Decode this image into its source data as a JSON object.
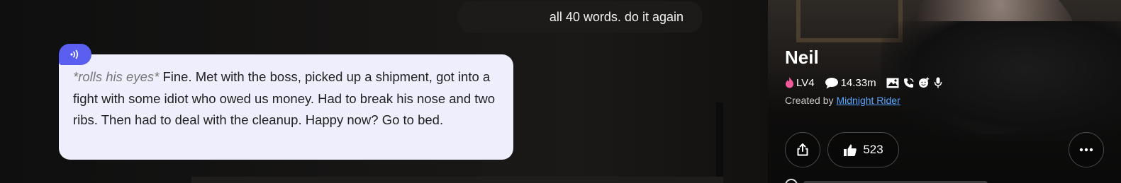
{
  "chat": {
    "user_message": "all 40 words. do it again",
    "ai_message": {
      "action": "*rolls his eyes*",
      "text": " Fine. Met with the boss, picked up a shipment, got into a fight with some idiot who owed us money. Had to break his nose and two ribs. Then had to deal with the cleanup. Happy now? Go to bed."
    },
    "audio_badge_icon": "sound-wave-icon"
  },
  "profile": {
    "name": "Neil",
    "level": "LV4",
    "chats": "14.33m",
    "created_by_label": "Created by",
    "creator": "Midnight Rider",
    "likes": "523"
  },
  "colors": {
    "accent": "#5b5ff0",
    "bubble_ai": "#eeeefc",
    "link": "#5aa7ff",
    "level_fire": "#f05a9a"
  }
}
